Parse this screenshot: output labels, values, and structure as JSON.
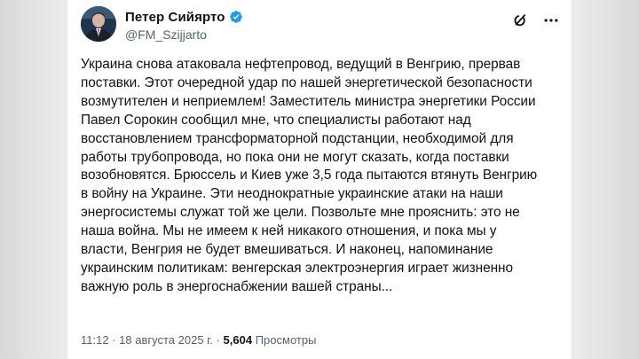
{
  "author": {
    "display_name": "Петер Сийярто",
    "handle": "@FM_Szijjarto",
    "verified": true,
    "avatar_icon": "profile-photo"
  },
  "actions": {
    "grok_icon": "grok-icon",
    "more_icon": "more-icon"
  },
  "tweet": {
    "lines": [
      "Украина снова атаковала нефтепровод, ведущий в Венгрию, прервав",
      "поставки. Этот очередной удар по нашей энергетической безопасности",
      "возмутителен и неприемлем! Заместитель министра энергетики России",
      "Павел Сорокин сообщил мне, что специалисты работают над",
      "восстановлением трансформаторной подстанции, необходимой для",
      "работы трубопровода, но пока они не могут сказать, когда поставки",
      "возобновятся. Брюссель и Киев уже 3,5 года пытаются втянуть Венгрию",
      "в войну на Украине. Эти неоднократные украинские атаки на наши",
      "энергосистемы служат той же цели. Позвольте мне прояснить: это не",
      "наша война. Мы не имеем к ней никакого отношения, и пока мы у",
      "власти, Венгрия не будет вмешиваться. И наконец, напоминание",
      "украинским политикам: венгерская электроэнергия играет жизненно",
      "важную роль в энергоснабжении вашей страны..."
    ]
  },
  "meta": {
    "time": "11:12",
    "separator": "·",
    "date": "18 августа 2025 г.",
    "views_count": "5,604",
    "views_label": "Просмотры"
  },
  "colors": {
    "text": "#0f1419",
    "secondary": "#536471",
    "verified_blue": "#1d9bf0"
  }
}
